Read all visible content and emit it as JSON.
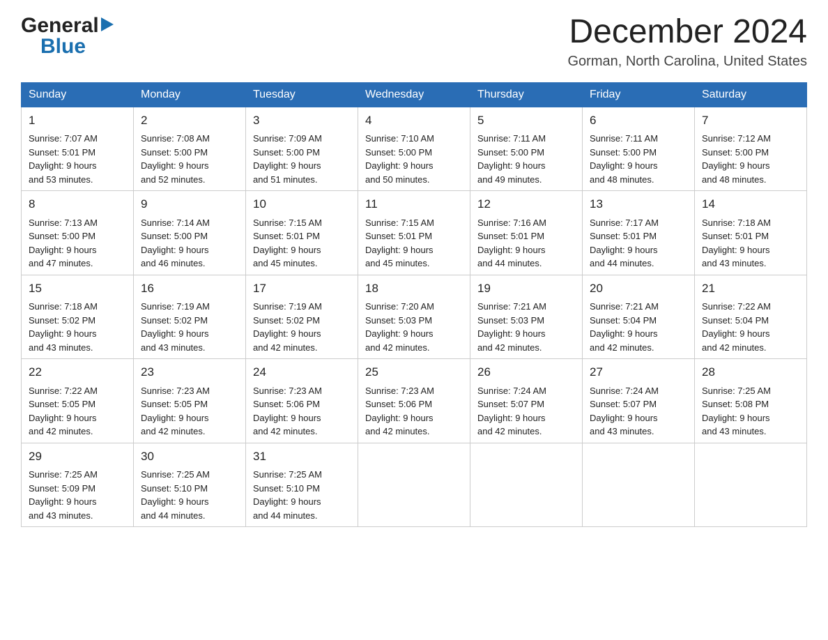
{
  "header": {
    "logo_general": "General",
    "logo_triangle": "▶",
    "logo_blue": "Blue",
    "month_title": "December 2024",
    "location": "Gorman, North Carolina, United States"
  },
  "days_of_week": [
    "Sunday",
    "Monday",
    "Tuesday",
    "Wednesday",
    "Thursday",
    "Friday",
    "Saturday"
  ],
  "weeks": [
    [
      {
        "day": "1",
        "sunrise": "7:07 AM",
        "sunset": "5:01 PM",
        "daylight": "9 hours and 53 minutes."
      },
      {
        "day": "2",
        "sunrise": "7:08 AM",
        "sunset": "5:00 PM",
        "daylight": "9 hours and 52 minutes."
      },
      {
        "day": "3",
        "sunrise": "7:09 AM",
        "sunset": "5:00 PM",
        "daylight": "9 hours and 51 minutes."
      },
      {
        "day": "4",
        "sunrise": "7:10 AM",
        "sunset": "5:00 PM",
        "daylight": "9 hours and 50 minutes."
      },
      {
        "day": "5",
        "sunrise": "7:11 AM",
        "sunset": "5:00 PM",
        "daylight": "9 hours and 49 minutes."
      },
      {
        "day": "6",
        "sunrise": "7:11 AM",
        "sunset": "5:00 PM",
        "daylight": "9 hours and 48 minutes."
      },
      {
        "day": "7",
        "sunrise": "7:12 AM",
        "sunset": "5:00 PM",
        "daylight": "9 hours and 48 minutes."
      }
    ],
    [
      {
        "day": "8",
        "sunrise": "7:13 AM",
        "sunset": "5:00 PM",
        "daylight": "9 hours and 47 minutes."
      },
      {
        "day": "9",
        "sunrise": "7:14 AM",
        "sunset": "5:00 PM",
        "daylight": "9 hours and 46 minutes."
      },
      {
        "day": "10",
        "sunrise": "7:15 AM",
        "sunset": "5:01 PM",
        "daylight": "9 hours and 45 minutes."
      },
      {
        "day": "11",
        "sunrise": "7:15 AM",
        "sunset": "5:01 PM",
        "daylight": "9 hours and 45 minutes."
      },
      {
        "day": "12",
        "sunrise": "7:16 AM",
        "sunset": "5:01 PM",
        "daylight": "9 hours and 44 minutes."
      },
      {
        "day": "13",
        "sunrise": "7:17 AM",
        "sunset": "5:01 PM",
        "daylight": "9 hours and 44 minutes."
      },
      {
        "day": "14",
        "sunrise": "7:18 AM",
        "sunset": "5:01 PM",
        "daylight": "9 hours and 43 minutes."
      }
    ],
    [
      {
        "day": "15",
        "sunrise": "7:18 AM",
        "sunset": "5:02 PM",
        "daylight": "9 hours and 43 minutes."
      },
      {
        "day": "16",
        "sunrise": "7:19 AM",
        "sunset": "5:02 PM",
        "daylight": "9 hours and 43 minutes."
      },
      {
        "day": "17",
        "sunrise": "7:19 AM",
        "sunset": "5:02 PM",
        "daylight": "9 hours and 42 minutes."
      },
      {
        "day": "18",
        "sunrise": "7:20 AM",
        "sunset": "5:03 PM",
        "daylight": "9 hours and 42 minutes."
      },
      {
        "day": "19",
        "sunrise": "7:21 AM",
        "sunset": "5:03 PM",
        "daylight": "9 hours and 42 minutes."
      },
      {
        "day": "20",
        "sunrise": "7:21 AM",
        "sunset": "5:04 PM",
        "daylight": "9 hours and 42 minutes."
      },
      {
        "day": "21",
        "sunrise": "7:22 AM",
        "sunset": "5:04 PM",
        "daylight": "9 hours and 42 minutes."
      }
    ],
    [
      {
        "day": "22",
        "sunrise": "7:22 AM",
        "sunset": "5:05 PM",
        "daylight": "9 hours and 42 minutes."
      },
      {
        "day": "23",
        "sunrise": "7:23 AM",
        "sunset": "5:05 PM",
        "daylight": "9 hours and 42 minutes."
      },
      {
        "day": "24",
        "sunrise": "7:23 AM",
        "sunset": "5:06 PM",
        "daylight": "9 hours and 42 minutes."
      },
      {
        "day": "25",
        "sunrise": "7:23 AM",
        "sunset": "5:06 PM",
        "daylight": "9 hours and 42 minutes."
      },
      {
        "day": "26",
        "sunrise": "7:24 AM",
        "sunset": "5:07 PM",
        "daylight": "9 hours and 42 minutes."
      },
      {
        "day": "27",
        "sunrise": "7:24 AM",
        "sunset": "5:07 PM",
        "daylight": "9 hours and 43 minutes."
      },
      {
        "day": "28",
        "sunrise": "7:25 AM",
        "sunset": "5:08 PM",
        "daylight": "9 hours and 43 minutes."
      }
    ],
    [
      {
        "day": "29",
        "sunrise": "7:25 AM",
        "sunset": "5:09 PM",
        "daylight": "9 hours and 43 minutes."
      },
      {
        "day": "30",
        "sunrise": "7:25 AM",
        "sunset": "5:10 PM",
        "daylight": "9 hours and 44 minutes."
      },
      {
        "day": "31",
        "sunrise": "7:25 AM",
        "sunset": "5:10 PM",
        "daylight": "9 hours and 44 minutes."
      },
      null,
      null,
      null,
      null
    ]
  ],
  "labels": {
    "sunrise": "Sunrise:",
    "sunset": "Sunset:",
    "daylight": "Daylight:"
  }
}
